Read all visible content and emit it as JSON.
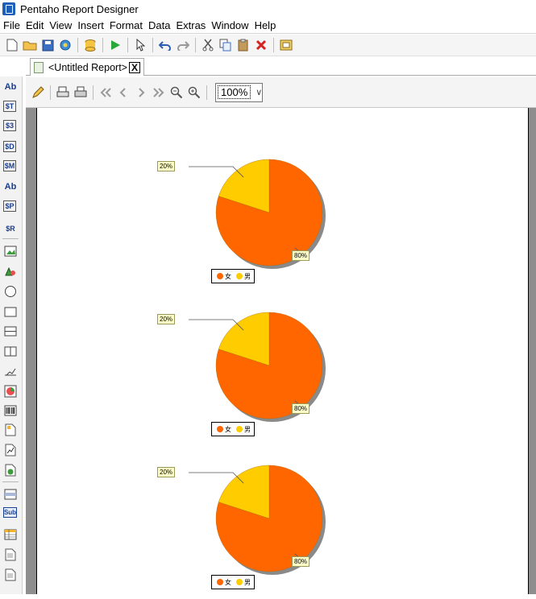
{
  "window": {
    "title": "Pentaho Report Designer"
  },
  "menu": [
    "File",
    "Edit",
    "View",
    "Insert",
    "Format",
    "Data",
    "Extras",
    "Window",
    "Help"
  ],
  "toolbar": {
    "icons": [
      "new-file-icon",
      "open-folder-icon",
      "save-icon",
      "publish-icon",
      "datasource-icon",
      "run-icon",
      "select-icon",
      "undo-icon",
      "redo-icon",
      "cut-icon",
      "copy-icon",
      "paste-icon",
      "delete-icon",
      "wizard-icon"
    ]
  },
  "tab": {
    "label": "<Untitled Report>",
    "close": "X"
  },
  "palette": [
    "Ab",
    "$T",
    "$3",
    "$D",
    "$M",
    "Ab",
    "$P",
    "$R",
    "",
    "",
    "",
    "",
    "",
    "",
    "",
    "",
    "",
    "",
    "",
    "",
    "Sub",
    "",
    "",
    ""
  ],
  "zoom": {
    "value": "100%"
  },
  "colors": {
    "female": "#ff6600",
    "male": "#ffcc00",
    "page_bg": "#8e8e8e"
  },
  "charts": [
    {
      "slices": [
        {
          "label": "女",
          "percent": 80,
          "label_text": "80%"
        },
        {
          "label": "男",
          "percent": 20,
          "label_text": "20%"
        }
      ]
    },
    {
      "slices": [
        {
          "label": "女",
          "percent": 80,
          "label_text": "80%"
        },
        {
          "label": "男",
          "percent": 20,
          "label_text": "20%"
        }
      ]
    },
    {
      "slices": [
        {
          "label": "女",
          "percent": 80,
          "label_text": "80%"
        },
        {
          "label": "男",
          "percent": 20,
          "label_text": "20%"
        }
      ]
    }
  ],
  "chart_data": [
    {
      "type": "pie",
      "categories": [
        "女",
        "男"
      ],
      "values": [
        80,
        20
      ],
      "colors": [
        "#ff6600",
        "#ffcc00"
      ],
      "legend": "bottom"
    },
    {
      "type": "pie",
      "categories": [
        "女",
        "男"
      ],
      "values": [
        80,
        20
      ],
      "colors": [
        "#ff6600",
        "#ffcc00"
      ],
      "legend": "bottom"
    },
    {
      "type": "pie",
      "categories": [
        "女",
        "男"
      ],
      "values": [
        80,
        20
      ],
      "colors": [
        "#ff6600",
        "#ffcc00"
      ],
      "legend": "bottom"
    }
  ]
}
